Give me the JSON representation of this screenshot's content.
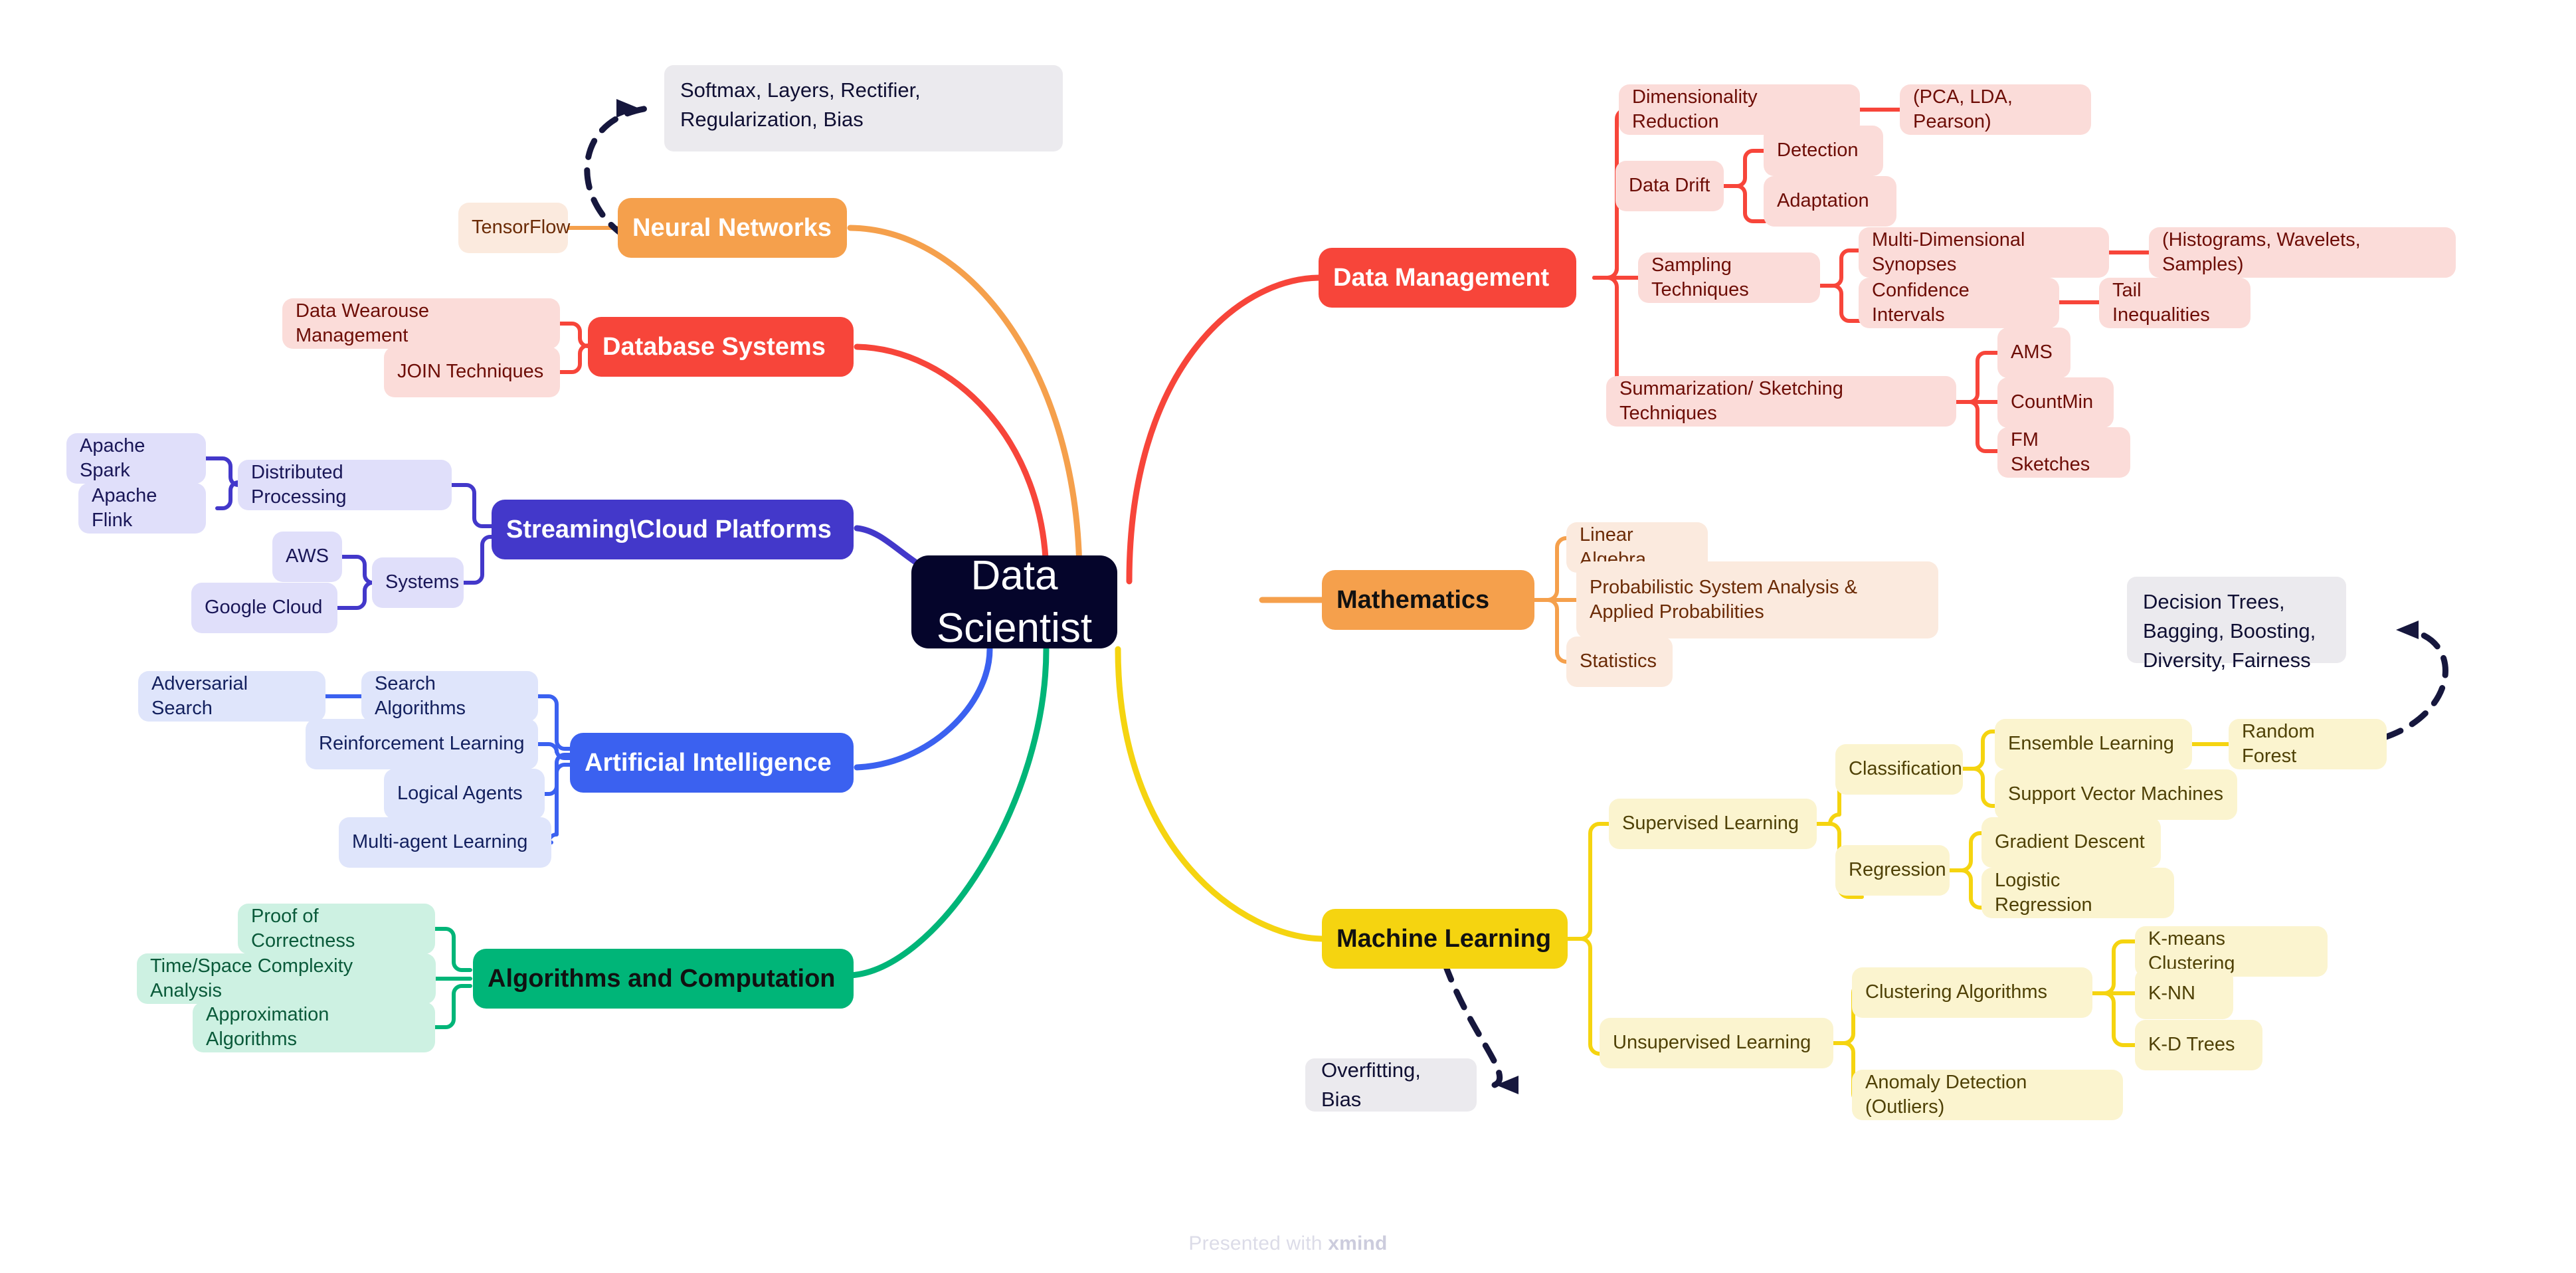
{
  "title": "Data Scientist",
  "footer": {
    "prefix": "Presented with ",
    "brand": "xmind"
  },
  "colors": {
    "root_bg": "#05052b",
    "neural_networks": "#f5a04c",
    "database_systems": "#f7453a",
    "streaming_cloud": "#4338ca",
    "artificial_intelligence": "#3b61f0",
    "algorithms": "#00b578",
    "data_management": "#f7453a",
    "mathematics": "#f5a04c",
    "machine_learning": "#f5d410",
    "note_bg": "#ebeaee"
  },
  "root": {
    "label": "Data Scientist"
  },
  "branches": {
    "neural_networks": {
      "label": "Neural Networks",
      "children": [
        {
          "label": "TensorFlow"
        }
      ],
      "note": "Softmax, Layers, Rectifier, Regularization, Bias"
    },
    "database_systems": {
      "label": "Database Systems",
      "children": [
        {
          "label": "Data Wearouse Management"
        },
        {
          "label": "JOIN Techniques"
        }
      ]
    },
    "streaming_cloud": {
      "label": "Streaming\\Cloud Platforms",
      "children": [
        {
          "label": "Distributed Processing",
          "children": [
            {
              "label": "Apache Spark"
            },
            {
              "label": "Apache Flink"
            }
          ]
        },
        {
          "label": "Systems",
          "children": [
            {
              "label": "AWS"
            },
            {
              "label": "Google Cloud"
            }
          ]
        }
      ]
    },
    "artificial_intelligence": {
      "label": "Artificial Intelligence",
      "children": [
        {
          "label": "Search Algorithms",
          "children": [
            {
              "label": "Adversarial Search"
            }
          ]
        },
        {
          "label": "Reinforcement Learning"
        },
        {
          "label": "Logical Agents"
        },
        {
          "label": "Multi-agent Learning"
        }
      ]
    },
    "algorithms": {
      "label": "Algorithms and Computation",
      "children": [
        {
          "label": "Proof of Correctness"
        },
        {
          "label": "Time/Space Complexity Analysis"
        },
        {
          "label": "Approximation Algorithms"
        }
      ]
    },
    "data_management": {
      "label": "Data Management",
      "children": [
        {
          "label": "Dimensionality Reduction",
          "children": [
            {
              "label": "(PCA, LDA, Pearson)"
            }
          ]
        },
        {
          "label": "Data Drift",
          "children": [
            {
              "label": "Detection"
            },
            {
              "label": "Adaptation"
            }
          ]
        },
        {
          "label": "Sampling Techniques",
          "children": [
            {
              "label": "Multi-Dimensional Synopses",
              "children": [
                {
                  "label": "(Histograms, Wavelets, Samples)"
                }
              ]
            },
            {
              "label": "Confidence Intervals",
              "children": [
                {
                  "label": "Tail Inequalities"
                }
              ]
            }
          ]
        },
        {
          "label": "Summarization/ Sketching Techniques",
          "children": [
            {
              "label": "AMS"
            },
            {
              "label": "CountMin"
            },
            {
              "label": "FM Sketches"
            }
          ]
        }
      ]
    },
    "mathematics": {
      "label": "Mathematics",
      "children": [
        {
          "label": "Linear Algebra"
        },
        {
          "label": "Probabilistic System Analysis & Applied Probabilities"
        },
        {
          "label": "Statistics"
        }
      ]
    },
    "machine_learning": {
      "label": "Machine Learning",
      "note": "Overfitting, Bias",
      "children": [
        {
          "label": "Supervised Learning",
          "children": [
            {
              "label": "Classification",
              "children": [
                {
                  "label": "Ensemble Learning",
                  "children": [
                    {
                      "label": "Random Forest",
                      "note": "Decision Trees, Bagging, Boosting, Diversity, Fairness"
                    }
                  ]
                },
                {
                  "label": "Support Vector Machines"
                }
              ]
            },
            {
              "label": "Regression",
              "children": [
                {
                  "label": "Gradient Descent"
                },
                {
                  "label": "Logistic Regression"
                }
              ]
            }
          ]
        },
        {
          "label": "Unsupervised Learning",
          "children": [
            {
              "label": "Clustering Algorithms",
              "children": [
                {
                  "label": "K-means Clustering"
                },
                {
                  "label": "K-NN"
                },
                {
                  "label": "K-D Trees"
                }
              ]
            },
            {
              "label": "Anomaly Detection (Outliers)"
            }
          ]
        }
      ]
    }
  },
  "notes": {
    "neural_note": "Softmax, Layers, Rectifier, Regularization, Bias",
    "decision_trees_note": "Decision Trees, Bagging, Boosting, Diversity, Fairness",
    "overfitting_note": "Overfitting, Bias"
  }
}
